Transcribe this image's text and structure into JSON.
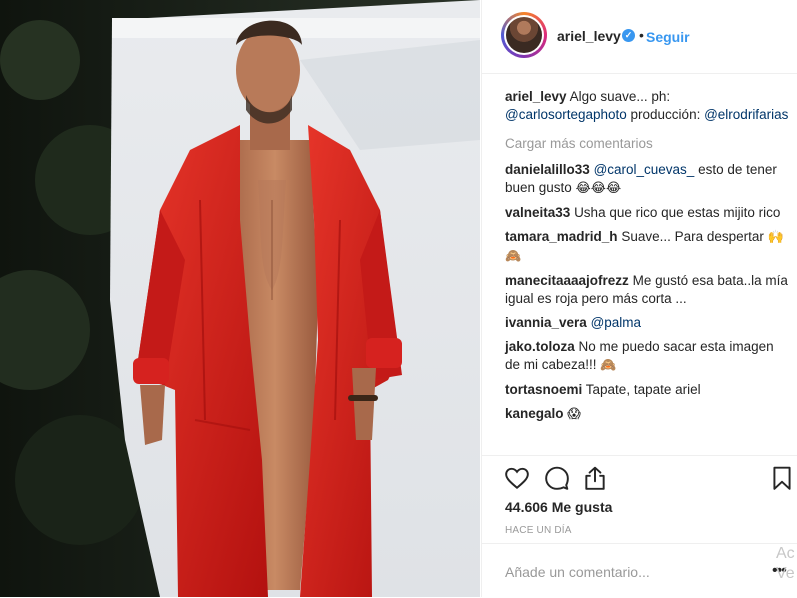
{
  "post": {
    "username": "ariel_levy",
    "follow_label": "Seguir",
    "separator": "•",
    "verified_mark": "✓",
    "caption": {
      "user": "ariel_levy",
      "text": "Algo suave... ph:",
      "mention1": "@carlosortegaphoto",
      "text2": " producción:",
      "mention2": "@elrodrifarias"
    },
    "load_more": "Cargar más comentarios",
    "comments": [
      {
        "user": "danielalillo33",
        "mention": "@carol_cuevas_",
        "text": " esto de tener buen gusto ",
        "emoji": "😂😂😂"
      },
      {
        "user": "valneita33",
        "mention": "",
        "text": "Usha que rico que estas mijito rico",
        "emoji": ""
      },
      {
        "user": "tamara_madrid_h",
        "mention": "",
        "text": "Suave... Para despertar",
        "emoji": "🙌🙈"
      },
      {
        "user": "manecitaaaajofrezz",
        "mention": "",
        "text": "Me gustó esa bata..la mía igual es roja pero más corta ...",
        "emoji": ""
      },
      {
        "user": "ivannia_vera",
        "mention": "@palma",
        "text": "",
        "emoji": ""
      },
      {
        "user": "jako.toloza",
        "mention": "",
        "text": "No me puedo sacar esta imagen de mi cabeza!!! ",
        "emoji": "🙈"
      },
      {
        "user": "tortasnoemi",
        "mention": "",
        "text": "Tapate, tapate ariel",
        "emoji": ""
      },
      {
        "user": "kanegalo",
        "mention": "",
        "text": "",
        "emoji": "😱"
      }
    ],
    "likes": "44.606 Me gusta",
    "time": "HACE UN DÍA",
    "add_comment_placeholder": "Añade un comentario...",
    "more_label": "•••",
    "overlay_text": "Ac\nVe"
  },
  "icons": [
    "heart-icon",
    "comment-icon",
    "share-icon",
    "bookmark-icon",
    "verified-icon"
  ],
  "colors": {
    "link_blue": "#3897f0",
    "mention_blue": "#003569",
    "muted_gray": "#999999",
    "coat_red": "#d81f1f"
  }
}
